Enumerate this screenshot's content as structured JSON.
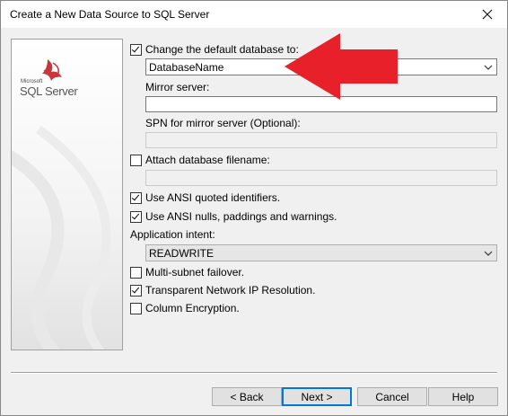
{
  "window": {
    "title": "Create a New Data Source to SQL Server"
  },
  "logo": {
    "microsoft_text": "Microsoft",
    "product_text": "SQL Server"
  },
  "form": {
    "change_default_db": {
      "label": "Change the default database to:",
      "checked": true
    },
    "database_combo": {
      "value": "DatabaseName"
    },
    "mirror_server": {
      "label": "Mirror server:",
      "value": ""
    },
    "spn_mirror": {
      "label": "SPN for mirror server (Optional):",
      "value": ""
    },
    "attach_db": {
      "label": "Attach database filename:",
      "checked": false,
      "value": ""
    },
    "ansi_quoted": {
      "label": "Use ANSI quoted identifiers.",
      "checked": true
    },
    "ansi_nulls": {
      "label": "Use ANSI nulls, paddings and warnings.",
      "checked": true
    },
    "application_intent": {
      "label": "Application intent:",
      "value": "READWRITE"
    },
    "multi_subnet": {
      "label": "Multi-subnet failover.",
      "checked": false
    },
    "transparent_ip": {
      "label": "Transparent Network IP Resolution.",
      "checked": true
    },
    "column_encryption": {
      "label": "Column Encryption.",
      "checked": false
    }
  },
  "buttons": {
    "back": "< Back",
    "next": "Next >",
    "cancel": "Cancel",
    "help": "Help"
  },
  "colors": {
    "annotation_arrow": "#e8202a",
    "focus_border": "#0078d7"
  },
  "icons": {
    "close": "close-icon",
    "dropdown": "chevron-down-icon",
    "logo": "sql-server-logo-icon"
  }
}
